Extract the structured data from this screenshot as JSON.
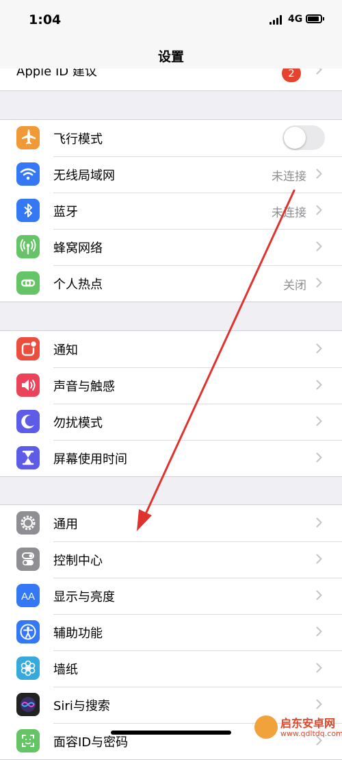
{
  "status_bar": {
    "time": "1:04",
    "network": "4G"
  },
  "nav": {
    "title": "设置"
  },
  "top_row": {
    "label": "Apple ID 建议",
    "badge": "2"
  },
  "groups": [
    [
      {
        "label": "飞行模式",
        "icon": "airplane-icon",
        "color": "#f09a37",
        "toggle": false
      },
      {
        "label": "无线局域网",
        "icon": "wifi-icon",
        "color": "#3478f6",
        "value": "未连接"
      },
      {
        "label": "蓝牙",
        "icon": "bluetooth-icon",
        "color": "#3478f6",
        "value": "未连接"
      },
      {
        "label": "蜂窝网络",
        "icon": "cellular-icon",
        "color": "#65c466"
      },
      {
        "label": "个人热点",
        "icon": "hotspot-icon",
        "color": "#65c466",
        "value": "关闭"
      }
    ],
    [
      {
        "label": "通知",
        "icon": "notifications-icon",
        "color": "#eb4e3d"
      },
      {
        "label": "声音与触感",
        "icon": "sound-icon",
        "color": "#eb445a"
      },
      {
        "label": "勿扰模式",
        "icon": "moon-icon",
        "color": "#5e5ce6"
      },
      {
        "label": "屏幕使用时间",
        "icon": "hourglass-icon",
        "color": "#5e5ce6"
      }
    ],
    [
      {
        "label": "通用",
        "icon": "gear-icon",
        "color": "#8e8e93"
      },
      {
        "label": "控制中心",
        "icon": "control-center-icon",
        "color": "#8e8e93"
      },
      {
        "label": "显示与亮度",
        "icon": "display-icon",
        "color": "#3478f6"
      },
      {
        "label": "辅助功能",
        "icon": "accessibility-icon",
        "color": "#3478f6"
      },
      {
        "label": "墙纸",
        "icon": "wallpaper-icon",
        "color": "#36aadc"
      },
      {
        "label": "Siri与搜索",
        "icon": "siri-icon",
        "color": "#222222"
      },
      {
        "label": "面容ID与密码",
        "icon": "faceid-icon",
        "color": "#65c466"
      }
    ]
  ],
  "watermark": {
    "title": "启东安卓网",
    "url": "www.qdltdq.com"
  }
}
